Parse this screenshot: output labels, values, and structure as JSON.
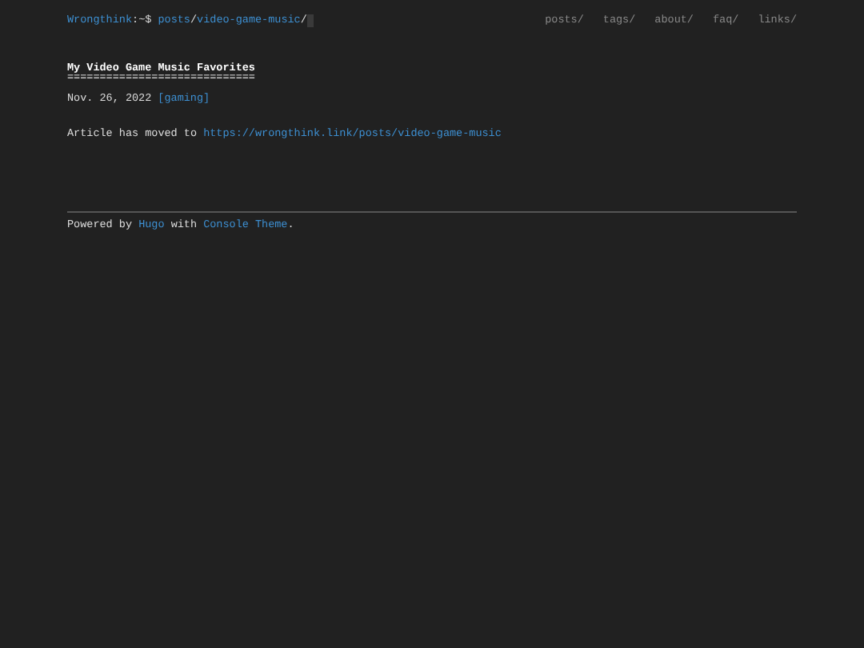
{
  "header": {
    "site": "Wrongthink",
    "prompt": ":~$ ",
    "path": [
      {
        "text": "posts",
        "link": true
      },
      {
        "text": "/",
        "link": false
      },
      {
        "text": "video-game-music",
        "link": true
      },
      {
        "text": "/",
        "link": false
      }
    ],
    "nav": [
      "posts/",
      "tags/",
      "about/",
      "faq/",
      "links/"
    ]
  },
  "post": {
    "title": "My Video Game Music Favorites",
    "underline": "=============================",
    "date": "Nov. 26, 2022",
    "tags": [
      "[gaming]"
    ],
    "body": [
      {
        "text": "Article has moved to ",
        "link": false
      },
      {
        "text": "https://wrongthink.link/posts/video-game-music",
        "link": true
      }
    ]
  },
  "footer": [
    {
      "text": "Powered by ",
      "link": false
    },
    {
      "text": "Hugo",
      "link": true
    },
    {
      "text": " with ",
      "link": false
    },
    {
      "text": "Console Theme",
      "link": true
    },
    {
      "text": ".",
      "link": false
    }
  ]
}
